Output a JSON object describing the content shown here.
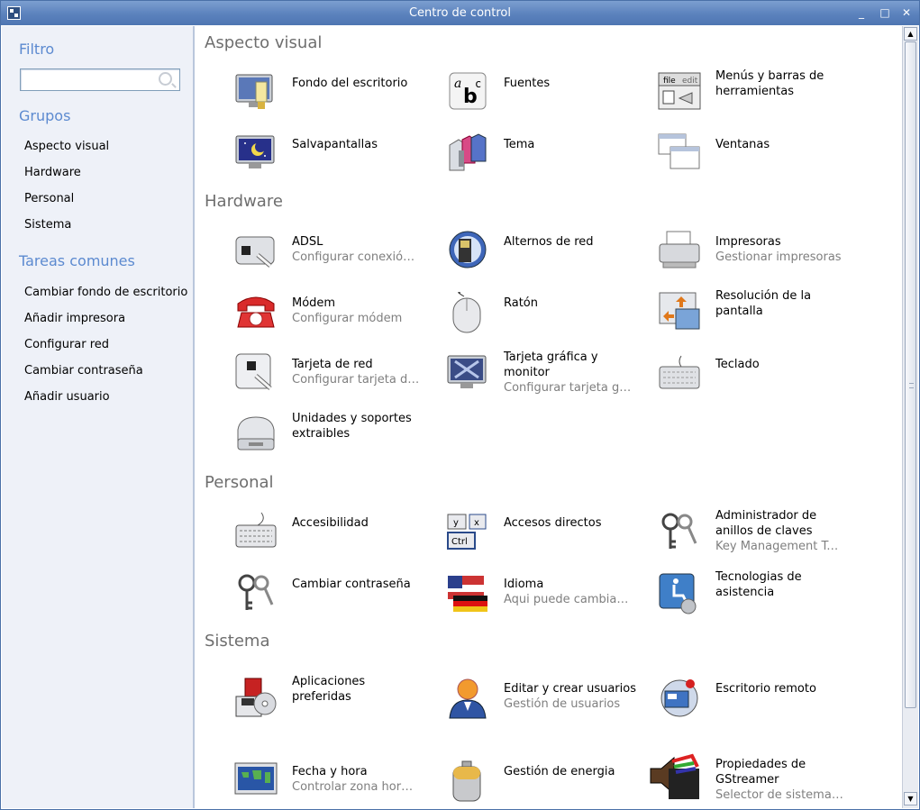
{
  "window": {
    "title": "Centro de control",
    "buttons": [
      "_",
      "□",
      "✕"
    ]
  },
  "sidebar": {
    "filter_heading": "Filtro",
    "search": {
      "value": "",
      "placeholder": ""
    },
    "groups_heading": "Grupos",
    "groups": [
      "Aspecto visual",
      "Hardware",
      "Personal",
      "Sistema"
    ],
    "tasks_heading": "Tareas comunes",
    "tasks": [
      "Cambiar fondo de escritorio",
      "Añadir impresora",
      "Configurar red",
      "Cambiar contraseña",
      "Añadir usuario"
    ]
  },
  "sections": [
    {
      "title": "Aspecto visual",
      "items": [
        {
          "label": "Fondo del escritorio",
          "sub": "",
          "icon": "desktop-background-icon"
        },
        {
          "label": "Fuentes",
          "sub": "",
          "icon": "fonts-icon"
        },
        {
          "label": "Menús y barras de herramientas",
          "sub": "",
          "icon": "menus-toolbars-icon"
        },
        {
          "label": "Salvapantallas",
          "sub": "",
          "icon": "screensaver-icon"
        },
        {
          "label": "Tema",
          "sub": "",
          "icon": "theme-icon"
        },
        {
          "label": "Ventanas",
          "sub": "",
          "icon": "windows-icon"
        }
      ]
    },
    {
      "title": "Hardware",
      "items": [
        {
          "label": "ADSL",
          "sub": "Configurar conexión ADSL",
          "icon": "adsl-icon"
        },
        {
          "label": "Alternos de red",
          "sub": "",
          "icon": "network-proxy-icon"
        },
        {
          "label": "Impresoras",
          "sub": "Gestionar impresoras",
          "icon": "printer-icon"
        },
        {
          "label": "Módem",
          "sub": "Configurar módem",
          "icon": "modem-phone-icon"
        },
        {
          "label": "Ratón",
          "sub": "",
          "icon": "mouse-icon"
        },
        {
          "label": "Resolución de la pantalla",
          "sub": "",
          "icon": "screen-resolution-icon"
        },
        {
          "label": "Tarjeta de red",
          "sub": "Configurar tarjeta de red",
          "icon": "network-card-icon"
        },
        {
          "label": "Tarjeta gráfica y monitor",
          "sub": "Configurar tarjeta gráfica",
          "icon": "graphics-monitor-icon"
        },
        {
          "label": "Teclado",
          "sub": "",
          "icon": "keyboard-icon"
        },
        {
          "label": "Unidades y soportes extraibles",
          "sub": "",
          "icon": "removable-drive-icon"
        }
      ]
    },
    {
      "title": "Personal",
      "items": [
        {
          "label": "Accesibilidad",
          "sub": "",
          "icon": "accessibility-keyboard-icon"
        },
        {
          "label": "Accesos directos",
          "sub": "",
          "icon": "shortcuts-keys-icon"
        },
        {
          "label": "Administrador de anillos de claves",
          "sub": "Key Management Tool",
          "icon": "keyring-icon"
        },
        {
          "label": "Cambiar contraseña",
          "sub": "",
          "icon": "password-keys-icon"
        },
        {
          "label": "Idioma",
          "sub": "Aqui puede cambiar el idioma",
          "icon": "language-flag-icon"
        },
        {
          "label": "Tecnologias de asistencia",
          "sub": "",
          "icon": "assistive-tech-icon"
        }
      ]
    },
    {
      "title": "Sistema",
      "items": [
        {
          "label": "Aplicaciones preferidas",
          "sub": "",
          "icon": "preferred-apps-icon"
        },
        {
          "label": "Editar y crear usuarios",
          "sub": "Gestión de usuarios",
          "icon": "user-icon"
        },
        {
          "label": "Escritorio remoto",
          "sub": "",
          "icon": "remote-desktop-icon"
        },
        {
          "label": "Fecha y hora",
          "sub": "Controlar zona horaria",
          "icon": "world-clock-icon"
        },
        {
          "label": "Gestión de energia",
          "sub": "",
          "icon": "battery-icon"
        },
        {
          "label": "Propiedades de GStreamer",
          "sub": "Selector de sistemas multimedia",
          "icon": "gstreamer-icon"
        }
      ]
    }
  ]
}
